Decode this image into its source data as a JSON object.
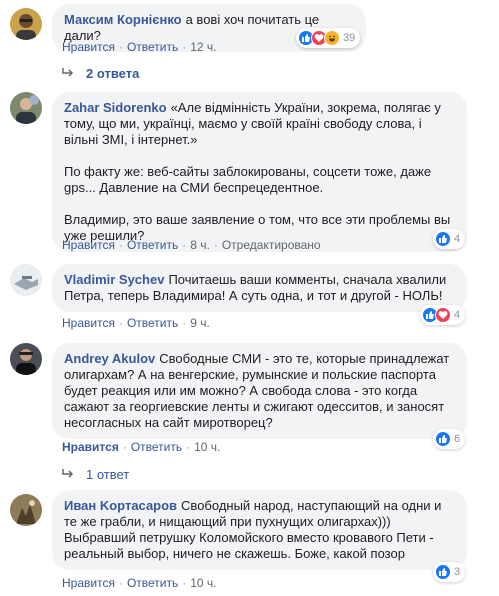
{
  "comments": [
    {
      "author": "Максим Корнієнко",
      "text": [
        "а вові хоч почитать це дали?"
      ],
      "like": "Нравится",
      "reply": "Ответить",
      "time": "12 ч.",
      "reaction_count": "39",
      "reaction_icons": [
        "like-icon",
        "love-icon",
        "haha-icon"
      ],
      "replies_label": "2 ответа"
    },
    {
      "author": "Zahar Sidorenko",
      "text": [
        "«Але відмінність України, зокрема, полягає у тому, що ми, українці, маємо у своїй країні свободу слова, і вільні ЗМІ, і інтернет.»",
        "По факту же: веб-сайты заблокированы, соцсети тоже, даже gps... Давление на СМИ беспрецедентное.",
        "Владимир, это ваше заявление о том, что все эти проблемы вы уже решили?"
      ],
      "like": "Нравится",
      "reply": "Ответить",
      "time": "8 ч.",
      "edited": "Отредактировано",
      "reaction_count": "4",
      "reaction_icons": [
        "like-icon"
      ]
    },
    {
      "author": "Vladimir Sychev",
      "text": [
        "Почитаешь ваши комменты, сначала хвалили Петра, теперь Владимира! А суть одна, и тот и другой - НОЛЬ!"
      ],
      "like": "Нравится",
      "reply": "Ответить",
      "time": "9 ч.",
      "reaction_count": "4",
      "reaction_icons": [
        "like-icon",
        "love-icon"
      ]
    },
    {
      "author": "Andrey Akulov",
      "text": [
        "Свободные СМИ - это те, которые принадлежат олигархам? А на венгерские, румынские и польские паспорта будет реакция или им можно? А свобода слова - это когда сажают за георгиевские ленты и сжигают одесситов, и заносят несогласных на сайт миротворец?"
      ],
      "like": "Нравится",
      "reply": "Ответить",
      "time": "10 ч.",
      "reaction_count": "6",
      "reaction_icons": [
        "like-icon"
      ],
      "replies_label": "1 ответ"
    },
    {
      "author": "Иван Kортасаров",
      "text": [
        "Свободный народ, наступающий на одни и те же грабли, и нищающий при пухнущих олигархах))) Выбравший петрушку Коломойского вместо кровавого Пети - реальный выбор, ничего не скажешь. Боже, какой позор"
      ],
      "like": "Нравится",
      "reply": "Ответить",
      "time": "10 ч.",
      "reaction_count": "3",
      "reaction_icons": [
        "like-icon"
      ]
    }
  ],
  "colors": {
    "link": "#385898",
    "meta": "#606770",
    "bubble": "#f2f3f5",
    "like_blue": "#1877f2",
    "love_red": "#f33e58",
    "haha_yellow": "#f7b125"
  }
}
